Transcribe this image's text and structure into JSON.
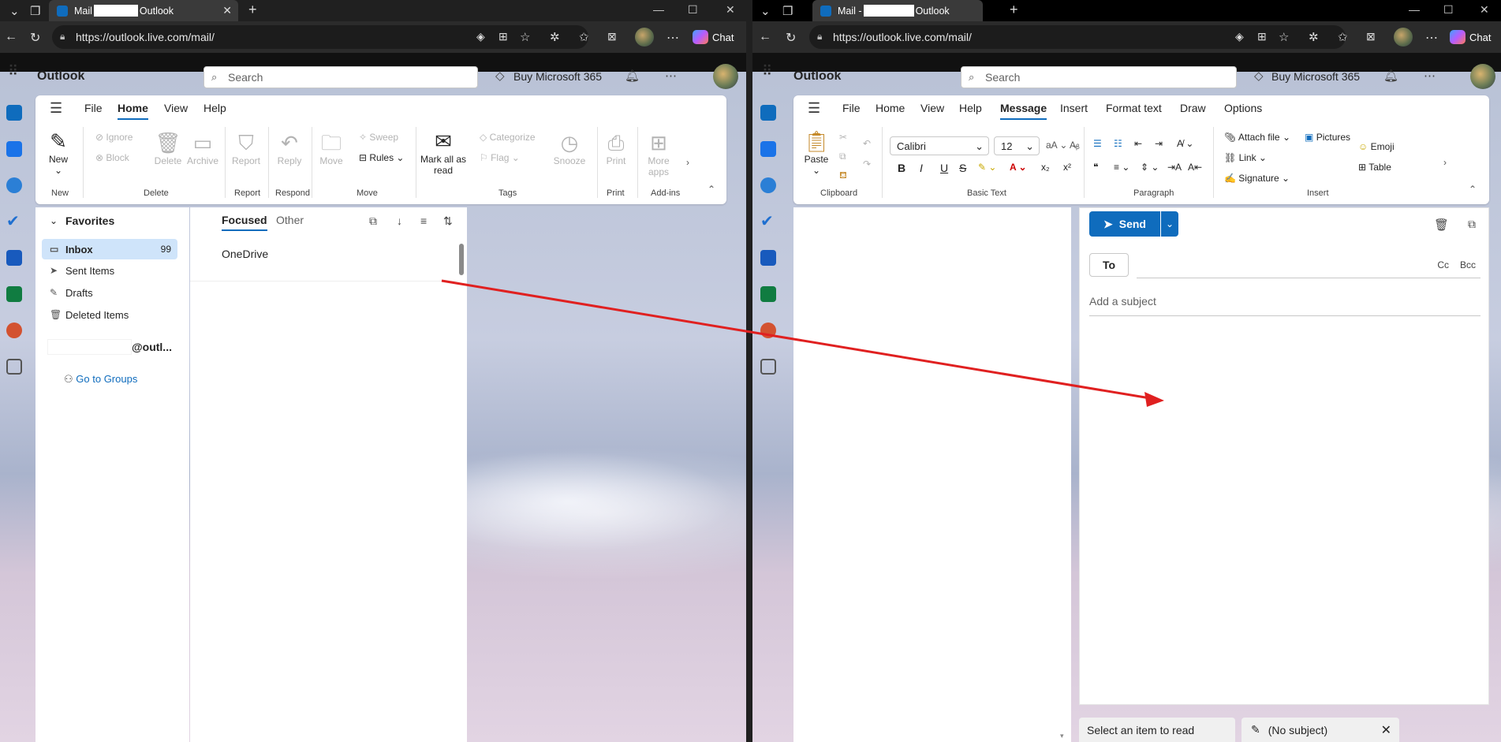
{
  "left": {
    "tab": {
      "title_prefix": "Mail",
      "title_suffix": "Outlook"
    },
    "url": "https://outlook.live.com/mail/",
    "chat_label": "Chat",
    "brand": "Outlook",
    "search_placeholder": "Search",
    "buy_label": "Buy Microsoft 365",
    "ribbon_tabs": [
      "File",
      "Home",
      "View",
      "Help"
    ],
    "ribbon": {
      "new": "New",
      "ignore": "Ignore",
      "block": "Block",
      "delete": "Delete",
      "archive": "Archive",
      "report": "Report",
      "reply": "Reply",
      "move": "Move",
      "sweep": "Sweep",
      "rules": "Rules",
      "mark_all_read": "Mark all as read",
      "categorize": "Categorize",
      "flag": "Flag",
      "snooze": "Snooze",
      "print": "Print",
      "more_apps": "More apps",
      "groups": [
        "New",
        "Delete",
        "Report",
        "Respond",
        "Move",
        "Tags",
        "Print",
        "Add-ins"
      ]
    },
    "favorites_label": "Favorites",
    "folders": [
      {
        "label": "Inbox",
        "count": "99"
      },
      {
        "label": "Sent Items"
      },
      {
        "label": "Drafts"
      },
      {
        "label": "Deleted Items"
      }
    ],
    "account_suffix": "@outl...",
    "go_to_groups": "Go to Groups",
    "list_tabs": [
      "Focused",
      "Other"
    ],
    "messages": [
      {
        "sender": "OneDrive"
      }
    ]
  },
  "right": {
    "tab": {
      "title_prefix": "Mail -",
      "title_suffix": "Outlook"
    },
    "url": "https://outlook.live.com/mail/",
    "chat_label": "Chat",
    "brand": "Outlook",
    "search_placeholder": "Search",
    "buy_label": "Buy Microsoft 365",
    "ribbon_tabs": [
      "File",
      "Home",
      "View",
      "Help",
      "Message",
      "Insert",
      "Format text",
      "Draw",
      "Options"
    ],
    "ribbon": {
      "paste": "Paste",
      "font": "Calibri",
      "size": "12",
      "attach_file": "Attach file",
      "pictures": "Pictures",
      "link": "Link",
      "emoji": "Emoji",
      "signature": "Signature",
      "table": "Table",
      "groups": [
        "Clipboard",
        "Basic Text",
        "Paragraph",
        "Insert"
      ]
    },
    "compose": {
      "send": "Send",
      "to": "To",
      "cc": "Cc",
      "bcc": "Bcc",
      "subject_placeholder": "Add a subject"
    },
    "status_left": "Select an item to read",
    "status_draft": "(No subject)"
  },
  "colors": {
    "accent": "#0f6cbd",
    "arrow": "#e02020",
    "selected": "#cfe4fa"
  }
}
